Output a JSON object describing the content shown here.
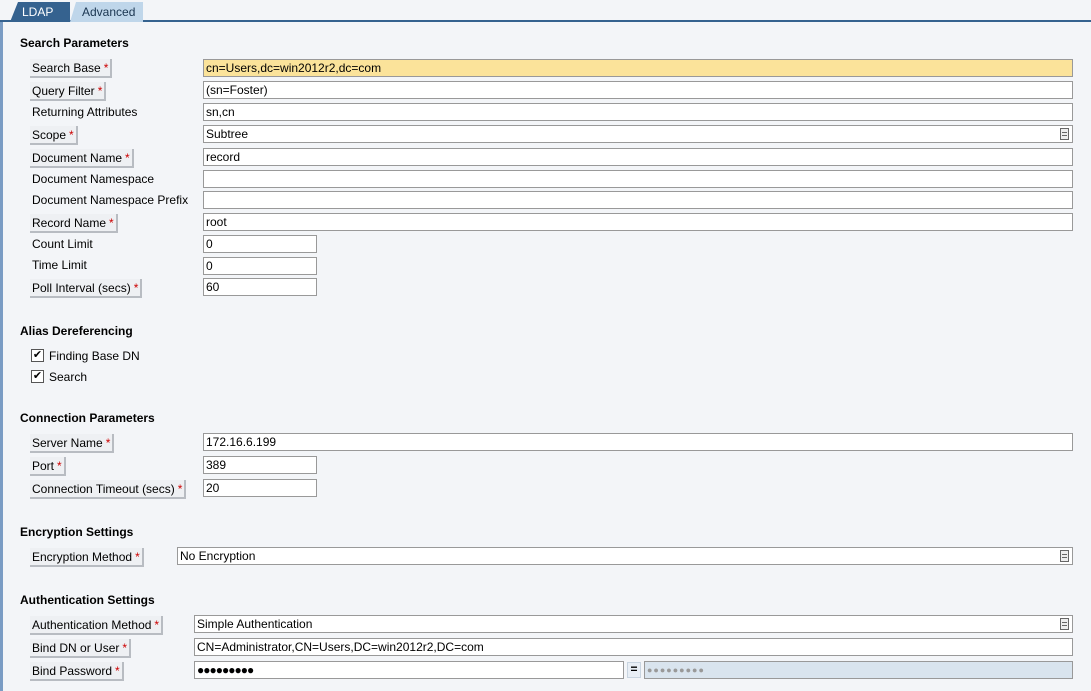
{
  "tabs": [
    "LDAP",
    "Advanced"
  ],
  "search": {
    "title": "Search Parameters",
    "search_base": {
      "label": "Search Base",
      "value": "cn=Users,dc=win2012r2,dc=com"
    },
    "query_filter": {
      "label": "Query Filter",
      "value": "(sn=Foster)"
    },
    "returning": {
      "label": "Returning Attributes",
      "value": "sn,cn"
    },
    "scope": {
      "label": "Scope",
      "value": "Subtree"
    },
    "doc_name": {
      "label": "Document Name",
      "value": "record"
    },
    "doc_ns": {
      "label": "Document Namespace",
      "value": ""
    },
    "doc_prefix": {
      "label": "Document Namespace Prefix",
      "value": ""
    },
    "record_name": {
      "label": "Record Name",
      "value": "root"
    },
    "count_limit": {
      "label": "Count Limit",
      "value": "0"
    },
    "time_limit": {
      "label": "Time Limit",
      "value": "0"
    },
    "poll": {
      "label": "Poll Interval (secs)",
      "value": "60"
    }
  },
  "alias": {
    "title": "Alias Dereferencing",
    "finding": {
      "label": "Finding Base DN",
      "checked": true
    },
    "search": {
      "label": "Search",
      "checked": true
    }
  },
  "connection": {
    "title": "Connection Parameters",
    "server": {
      "label": "Server Name",
      "value": "172.16.6.199"
    },
    "port": {
      "label": "Port",
      "value": "389"
    },
    "timeout": {
      "label": "Connection Timeout (secs)",
      "value": "20"
    }
  },
  "encryption": {
    "title": "Encryption Settings",
    "method": {
      "label": "Encryption Method",
      "value": "No Encryption"
    }
  },
  "auth": {
    "title": "Authentication Settings",
    "method": {
      "label": "Authentication Method",
      "value": "Simple Authentication"
    },
    "bind_dn": {
      "label": "Bind DN or User",
      "value": "CN=Administrator,CN=Users,DC=win2012r2,DC=com"
    },
    "password": {
      "label": "Bind Password",
      "value": "●●●●●●●●●",
      "confirm": "●●●●●●●●●",
      "eq": "="
    }
  },
  "required_mark": "*",
  "check_mark": "✔"
}
